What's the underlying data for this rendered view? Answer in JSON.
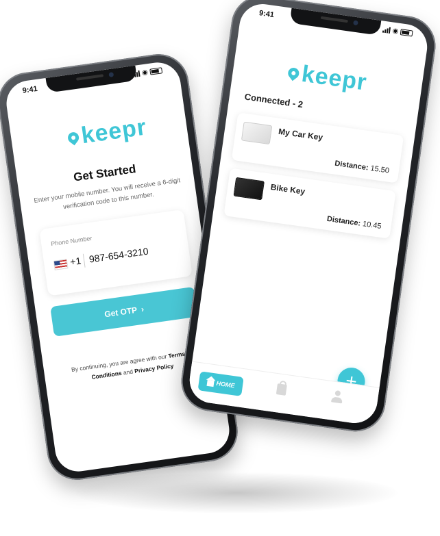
{
  "status_bar": {
    "time": "9:41"
  },
  "brand": {
    "logo_text": "keepr",
    "accent_color": "#3fc6d6"
  },
  "login_screen": {
    "title": "Get Started",
    "subtitle": "Enter your mobile number. You will receive a 6-digit verification code to this number.",
    "phone_field": {
      "label": "Phone Number",
      "country_flag_icon": "us-flag-icon",
      "country_code": "+1",
      "value": "987-654-3210"
    },
    "otp_button": {
      "label": "Get OTP",
      "icon": "chevron-right-icon"
    },
    "terms": {
      "prefix": "By continuing, you are agree with our",
      "terms_link": "Terms & Conditions",
      "connector": "and",
      "privacy_link": "Privacy Policy"
    }
  },
  "home_screen": {
    "connected_label": "Connected - 2",
    "devices": [
      {
        "name": "My Car Key",
        "distance_label": "Distance:",
        "distance_value": "15.50",
        "image": "white-tag"
      },
      {
        "name": "Bike Key",
        "distance_label": "Distance:",
        "distance_value": "10.45",
        "image": "black-tag"
      }
    ],
    "fab": {
      "icon": "plus-icon",
      "symbol": "+"
    },
    "tabs": [
      {
        "label": "HOME",
        "icon": "home-icon",
        "active": true
      },
      {
        "label": "",
        "icon": "bag-icon",
        "active": false
      },
      {
        "label": "",
        "icon": "user-icon",
        "active": false
      }
    ]
  }
}
